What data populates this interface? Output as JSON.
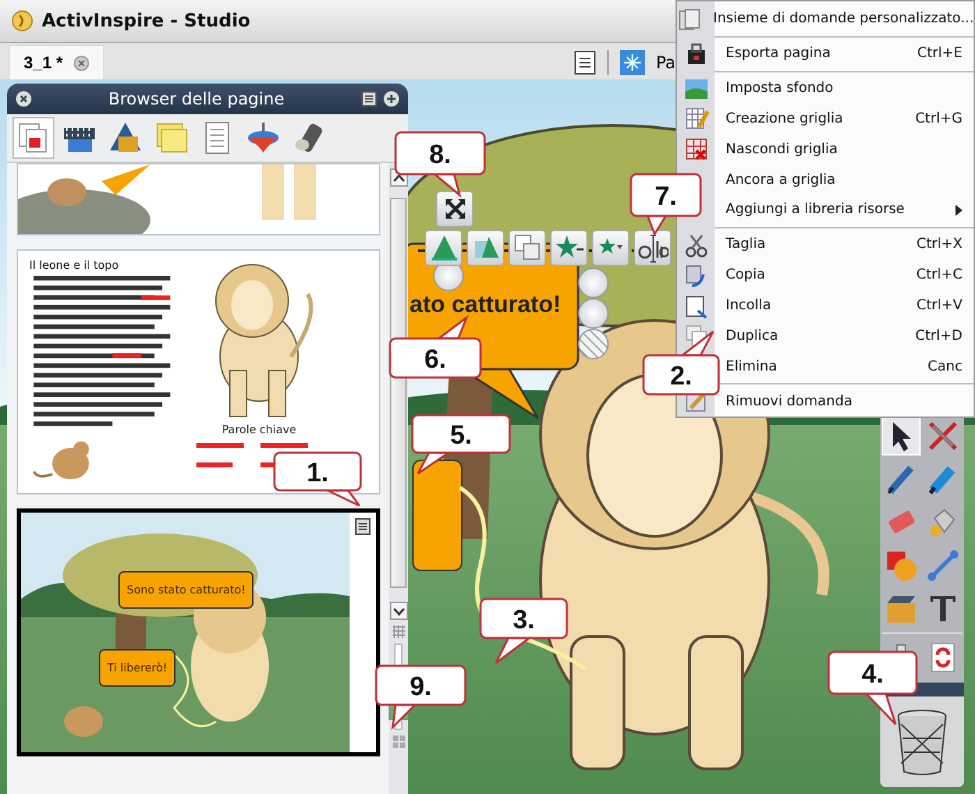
{
  "window": {
    "title": "ActivInspire - Studio"
  },
  "tabs": [
    {
      "label": "3_1 *",
      "selected": true
    }
  ],
  "toolbar": {
    "cut_label": "Pa"
  },
  "page_browser": {
    "title": "Browser delle pagine",
    "tabs": [
      {
        "selected": true
      },
      {
        "selected": false
      },
      {
        "selected": false
      },
      {
        "selected": false
      },
      {
        "selected": false
      },
      {
        "selected": false
      },
      {
        "selected": false
      }
    ],
    "pages": [
      {
        "kind": "picture",
        "selected": false
      },
      {
        "kind": "document",
        "selected": false,
        "title": "Il leone e il topo",
        "caption": "Parole chiave"
      },
      {
        "kind": "scene",
        "selected": true,
        "bubbles": [
          "Sono stato catturato!",
          "Ti libererò!"
        ]
      }
    ],
    "zoom_slider": {
      "level": 0.1
    }
  },
  "canvas": {
    "bubble_text": "ato catturato!"
  },
  "context_menu": {
    "items": [
      {
        "label": "Insieme di domande personalizzato...",
        "submenu": false,
        "separator_after": true
      },
      {
        "label": "Esporta pagina",
        "shortcut": "Ctrl+E",
        "submenu": false,
        "separator_after": true
      },
      {
        "label": "Imposta sfondo",
        "submenu": false,
        "separator_after": false
      },
      {
        "label": "Creazione griglia",
        "shortcut": "Ctrl+G",
        "submenu": false,
        "separator_after": false
      },
      {
        "label": "Nascondi griglia",
        "submenu": false,
        "separator_after": false
      },
      {
        "label": "Ancora a griglia",
        "submenu": false,
        "separator_after": false
      },
      {
        "label": "Aggiungi a libreria risorse",
        "submenu": true,
        "separator_after": true
      },
      {
        "label": "Taglia",
        "shortcut": "Ctrl+X",
        "submenu": false,
        "separator_after": false
      },
      {
        "label": "Copia",
        "shortcut": "Ctrl+C",
        "submenu": false,
        "separator_after": false
      },
      {
        "label": "Incolla",
        "shortcut": "Ctrl+V",
        "submenu": false,
        "separator_after": false
      },
      {
        "label": "Duplica",
        "shortcut": "Ctrl+D",
        "submenu": false,
        "separator_after": false
      },
      {
        "label": "Elimina",
        "shortcut": "Canc",
        "submenu": false,
        "separator_after": true
      },
      {
        "label": "Rimuovi domanda",
        "submenu": false,
        "separator_after": false
      }
    ]
  },
  "toolbox": {
    "tools": [
      {
        "selected": true
      },
      {
        "selected": false
      },
      {
        "selected": false
      },
      {
        "selected": false
      },
      {
        "selected": false
      },
      {
        "selected": false
      },
      {
        "selected": false
      },
      {
        "selected": false
      },
      {
        "selected": false
      },
      {
        "selected": false
      },
      {
        "selected": false
      },
      {
        "selected": false
      }
    ]
  },
  "callouts": [
    "1.",
    "2.",
    "3.",
    "4.",
    "5.",
    "6.",
    "7.",
    "8.",
    "9."
  ]
}
